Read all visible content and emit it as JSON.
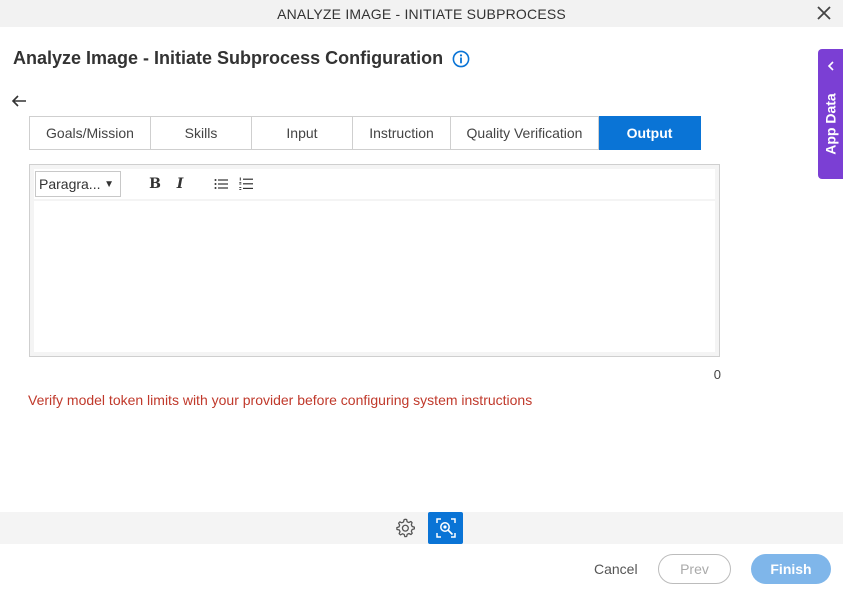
{
  "window": {
    "title": "ANALYZE IMAGE - INITIATE SUBPROCESS"
  },
  "page": {
    "heading": "Analyze Image - Initiate Subprocess Configuration"
  },
  "tabs": [
    {
      "label": "Goals/Mission"
    },
    {
      "label": "Skills"
    },
    {
      "label": "Input"
    },
    {
      "label": "Instruction"
    },
    {
      "label": "Quality Verification"
    },
    {
      "label": "Output",
      "active": true
    }
  ],
  "editor": {
    "format_selected": "Paragra...",
    "bold_label": "B",
    "italic_label": "I",
    "content": "",
    "char_count": "0"
  },
  "warning": "Verify model token limits with your provider before configuring system instructions",
  "footer": {
    "cancel": "Cancel",
    "prev": "Prev",
    "finish": "Finish"
  },
  "side_panel": {
    "label": "App Data"
  },
  "colors": {
    "accent": "#0a74d6",
    "warning": "#c0392b",
    "app_data": "#7b3fd4",
    "finish_disabled": "#7fb6ea"
  },
  "icons": [
    "close-icon",
    "info-icon",
    "back-arrow-icon",
    "bullet-list-icon",
    "numbered-list-icon",
    "gear-icon",
    "ai-image-icon",
    "chevron-left-icon"
  ]
}
